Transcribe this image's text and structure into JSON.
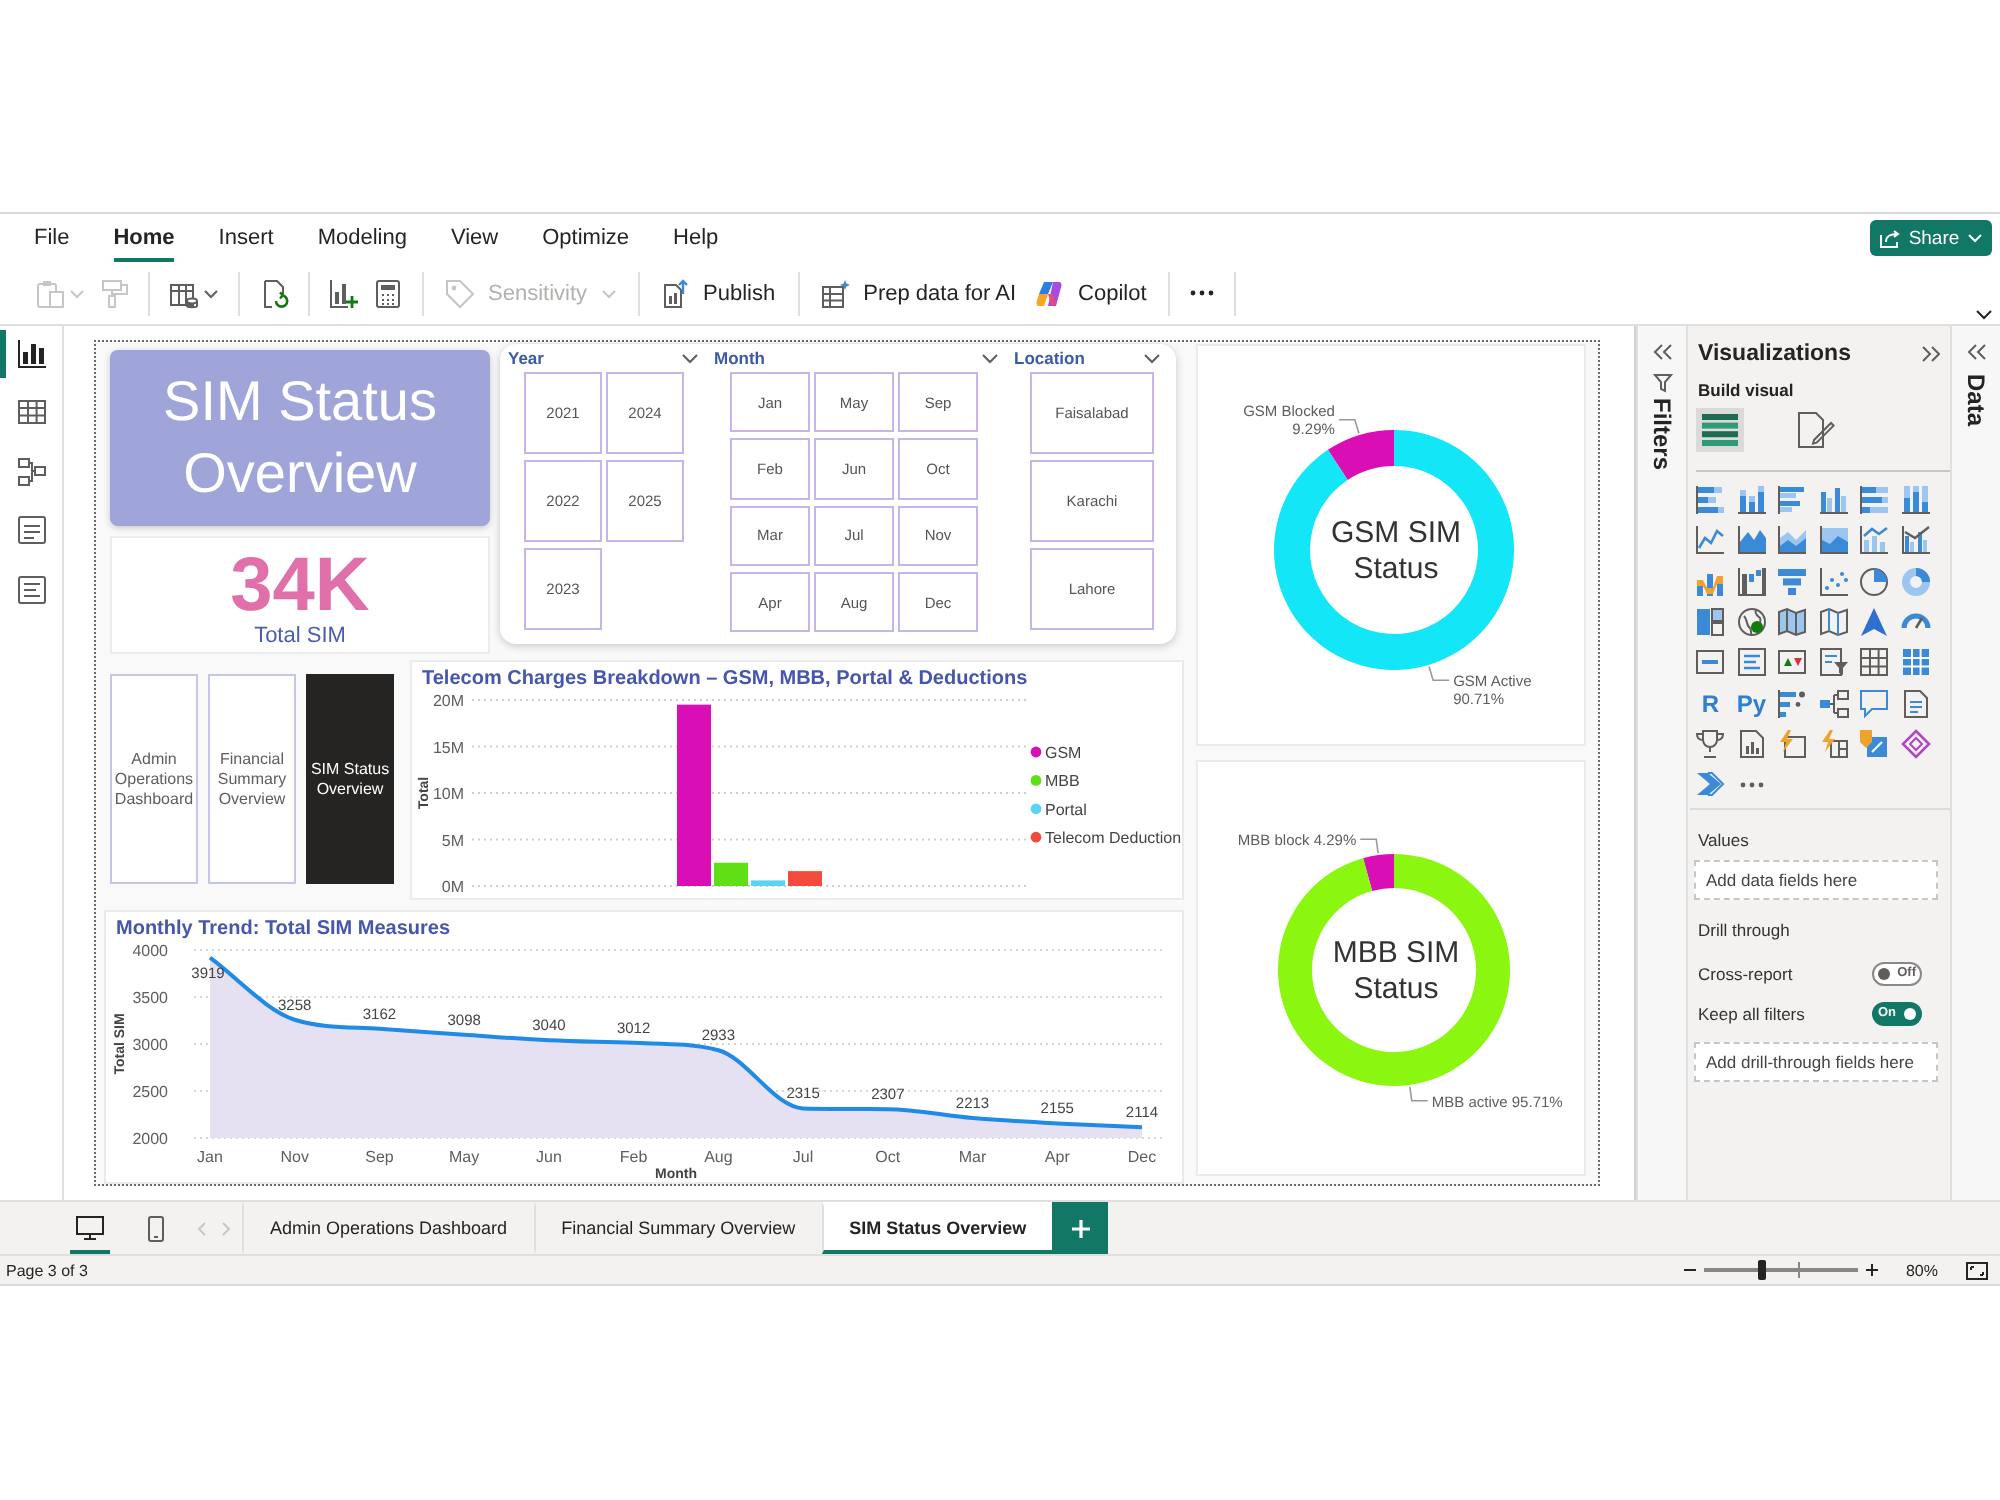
{
  "menu": [
    {
      "label": "File",
      "selected": false
    },
    {
      "label": "Home",
      "selected": true
    },
    {
      "label": "Insert",
      "selected": false
    },
    {
      "label": "Modeling",
      "selected": false
    },
    {
      "label": "View",
      "selected": false
    },
    {
      "label": "Optimize",
      "selected": false
    },
    {
      "label": "Help",
      "selected": false
    }
  ],
  "share_button": {
    "label": "Share"
  },
  "toolbar": {
    "icon_buttons": [
      {
        "disabled": true
      },
      {
        "disabled": true
      },
      {
        "disabled": false
      },
      {
        "disabled": false
      },
      {
        "disabled": false
      },
      {
        "disabled": false
      }
    ],
    "buttons": [
      {
        "label": "Sensitivity",
        "disabled": true
      },
      {
        "label": "Publish",
        "disabled": false
      },
      {
        "label": "Prep data for AI",
        "disabled": false
      },
      {
        "label": "Copilot",
        "disabled": false
      }
    ]
  },
  "left_rail": [
    {
      "selected": true
    },
    {
      "selected": false
    },
    {
      "selected": false
    },
    {
      "selected": false
    },
    {
      "selected": false
    }
  ],
  "report": {
    "title_banner": "SIM Status Overview",
    "kpi": {
      "value": "34K",
      "label": "Total SIM"
    },
    "slicers": [
      {
        "title": "Year",
        "items": [
          {
            "label": "2021",
            "selected": false
          },
          {
            "label": "2022",
            "selected": false
          },
          {
            "label": "2023",
            "selected": false
          },
          {
            "label": "2024",
            "selected": false
          },
          {
            "label": "2025",
            "selected": false
          }
        ]
      },
      {
        "title": "Month",
        "items": [
          {
            "label": "Jan",
            "selected": false
          },
          {
            "label": "Feb",
            "selected": false
          },
          {
            "label": "Mar",
            "selected": false
          },
          {
            "label": "Apr",
            "selected": false
          },
          {
            "label": "May",
            "selected": false
          },
          {
            "label": "Jun",
            "selected": false
          },
          {
            "label": "Jul",
            "selected": false
          },
          {
            "label": "Aug",
            "selected": false
          },
          {
            "label": "Sep",
            "selected": false
          },
          {
            "label": "Oct",
            "selected": false
          },
          {
            "label": "Nov",
            "selected": false
          },
          {
            "label": "Dec",
            "selected": false
          }
        ]
      },
      {
        "title": "Location",
        "items": [
          {
            "label": "Faisalabad",
            "selected": false
          },
          {
            "label": "Karachi",
            "selected": false
          },
          {
            "label": "Lahore",
            "selected": false
          }
        ]
      }
    ],
    "page_navigator": [
      {
        "label": "Admin Operations Dashboard",
        "selected": false
      },
      {
        "label": "Financial Summary Overview",
        "selected": false
      },
      {
        "label": "SIM Status Overview",
        "selected": true
      }
    ],
    "bar_chart": {
      "chart_data": {
        "type": "bar",
        "title": "Telecom Charges Breakdown – GSM, MBB, Portal & Deductions",
        "ylabel": "Total",
        "categories": [
          null
        ],
        "series": [
          {
            "name": "GSM",
            "color": "#d90fb5",
            "values": [
              19.5
            ]
          },
          {
            "name": "MBB",
            "color": "#5fe016",
            "values": [
              2.5
            ]
          },
          {
            "name": "Portal",
            "color": "#5bd3f5",
            "values": [
              0.6
            ]
          },
          {
            "name": "Telecom Deduction",
            "color": "#f24b3d",
            "values": [
              1.6
            ]
          }
        ],
        "ylim": [
          0,
          20
        ],
        "yticks": [
          {
            "value": 0,
            "label": "0M"
          },
          {
            "value": 5,
            "label": "5M"
          },
          {
            "value": 10,
            "label": "10M"
          },
          {
            "value": 15,
            "label": "15M"
          },
          {
            "value": 20,
            "label": "20M"
          }
        ],
        "grid": true,
        "legend": "right"
      }
    },
    "line_chart": {
      "chart_data": {
        "type": "area",
        "title": "Monthly Trend: Total SIM Measures",
        "xlabel": "Month",
        "ylabel": "Total SIM",
        "categories": [
          "Jan",
          "Nov",
          "Sep",
          "May",
          "Jun",
          "Feb",
          "Aug",
          "Jul",
          "Oct",
          "Mar",
          "Apr",
          "Dec"
        ],
        "values": [
          3919,
          3258,
          3162,
          3098,
          3040,
          3012,
          2933,
          2315,
          2307,
          2213,
          2155,
          2114
        ],
        "color": "#1f8be6",
        "ylim": [
          2000,
          4000
        ],
        "yticks": [
          2000,
          2500,
          3000,
          3500,
          4000
        ],
        "grid": true,
        "data_labels": true
      }
    },
    "donuts": [
      {
        "chart_data": {
          "type": "donut",
          "title": "GSM SIM Status",
          "categories": [
            "GSM Blocked",
            "GSM Active"
          ],
          "values": [
            9.29,
            90.71
          ],
          "colors": [
            "#d90fb5",
            "#12e6f7"
          ],
          "value_labels": [
            "9.29%",
            "90.71%"
          ]
        }
      },
      {
        "chart_data": {
          "type": "donut",
          "title": "MBB SIM Status",
          "categories": [
            "MBB block",
            "MBB active"
          ],
          "values": [
            4.29,
            95.71
          ],
          "colors": [
            "#d90fb5",
            "#8bf711"
          ],
          "value_labels": [
            "4.29%",
            "95.71%"
          ]
        }
      }
    ]
  },
  "filters_pane": {
    "label": "Filters"
  },
  "visualizations": {
    "title": "Visualizations",
    "subtitle": "Build visual",
    "modes": [
      {
        "selected": true
      },
      {
        "selected": false
      }
    ],
    "gallery_glyphs": [
      "R",
      "Py"
    ],
    "values": {
      "label": "Values",
      "placeholder": "Add data fields here"
    },
    "drill_through": {
      "label": "Drill through",
      "options": [
        {
          "label": "Cross-report",
          "on": false,
          "state_text": "Off"
        },
        {
          "label": "Keep all filters",
          "on": true,
          "state_text": "On"
        }
      ],
      "placeholder": "Add drill-through fields here"
    }
  },
  "data_pane": {
    "label": "Data"
  },
  "page_tabs": {
    "view_modes": [
      {
        "selected": true
      },
      {
        "selected": false
      }
    ],
    "page_nav": {
      "disabled": true
    },
    "tabs": [
      {
        "label": "Admin Operations Dashboard",
        "selected": false
      },
      {
        "label": "Financial Summary Overview",
        "selected": false
      },
      {
        "label": "SIM Status Overview",
        "selected": true
      }
    ]
  },
  "status_bar": {
    "page": "Page 3 of 3",
    "zoom": {
      "level": 0.38,
      "reading": "80%"
    }
  }
}
